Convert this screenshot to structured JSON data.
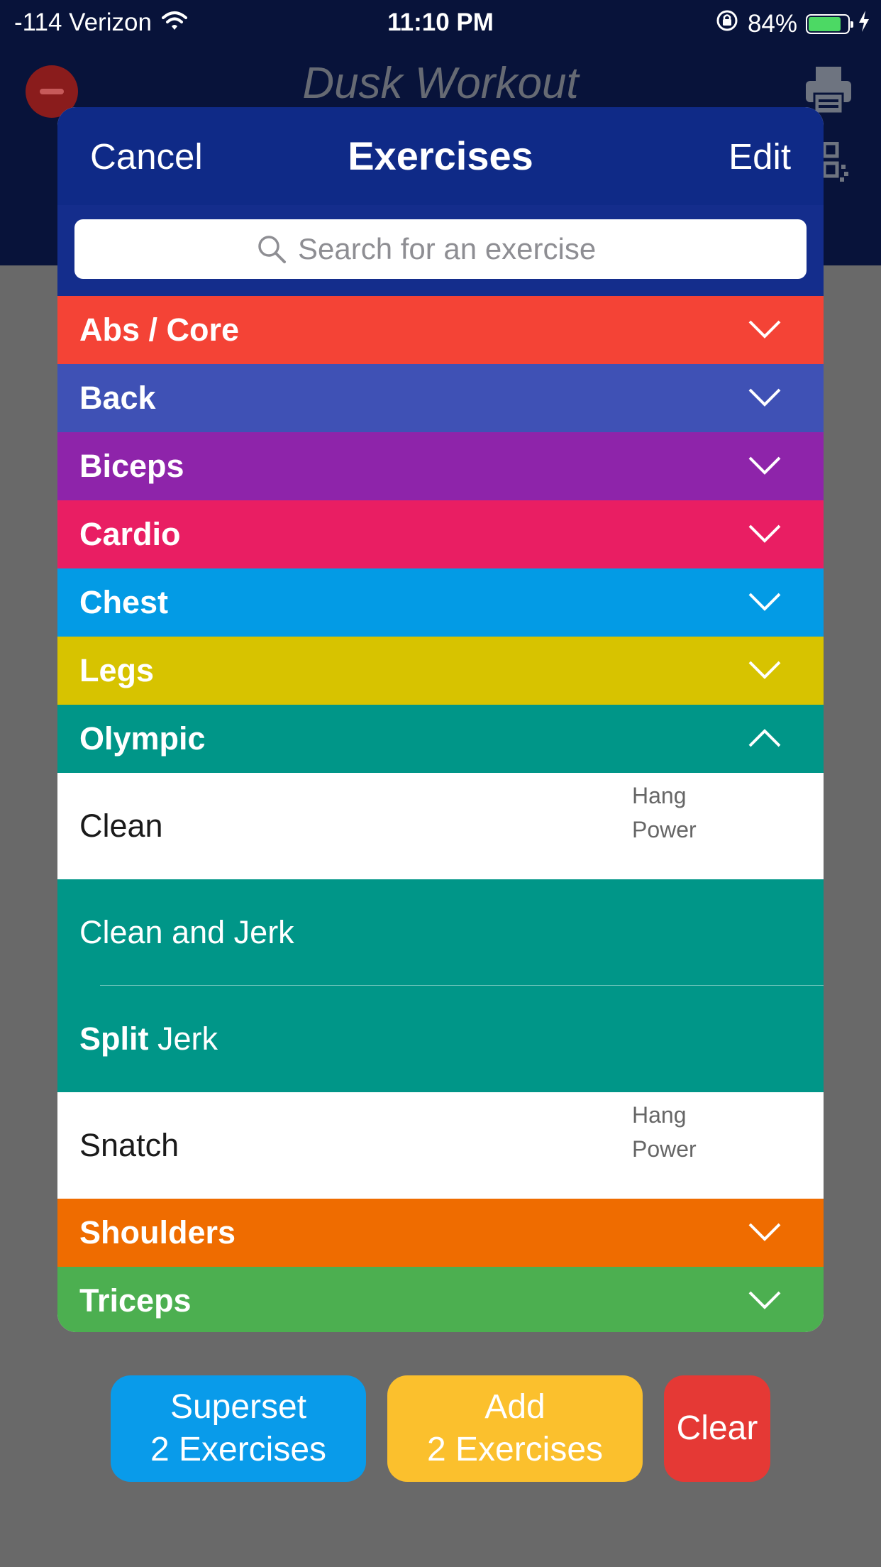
{
  "status_bar": {
    "carrier": "-114 Verizon",
    "time": "11:10 PM",
    "battery": "84%",
    "battery_level": 0.84
  },
  "background": {
    "title": "Dusk Workout",
    "remove_icon": "minus-circle-icon",
    "print_icon": "printer-icon",
    "qr_icon": "qr-code-icon"
  },
  "modal": {
    "cancel_label": "Cancel",
    "title": "Exercises",
    "edit_label": "Edit",
    "search_placeholder": "Search for an exercise"
  },
  "categories": [
    {
      "label": "Abs / Core",
      "color": "#f44336"
    },
    {
      "label": "Back",
      "color": "#3f51b5"
    },
    {
      "label": "Biceps",
      "color": "#8e24aa"
    },
    {
      "label": "Cardio",
      "color": "#e91e63"
    },
    {
      "label": "Chest",
      "color": "#039be5"
    },
    {
      "label": "Legs",
      "color": "#d7c300"
    },
    {
      "label": "Olympic",
      "color": "#009688",
      "expanded": true
    },
    {
      "label": "Shoulders",
      "color": "#ef6c00"
    },
    {
      "label": "Triceps",
      "color": "#4caf50"
    }
  ],
  "olympic_exercises": [
    {
      "name": "Clean",
      "variants": [
        "Hang",
        "Power"
      ],
      "selected": false
    },
    {
      "name": "Clean and Jerk",
      "selected": true
    },
    {
      "name_bold": "Split",
      "name_rest": " Jerk",
      "selected": true
    },
    {
      "name": "Snatch",
      "variants": [
        "Hang",
        "Power"
      ],
      "selected": false
    }
  ],
  "buttons": {
    "superset_line1": "Superset",
    "superset_line2": "2 Exercises",
    "add_line1": "Add",
    "add_line2": "2 Exercises",
    "clear": "Clear"
  }
}
